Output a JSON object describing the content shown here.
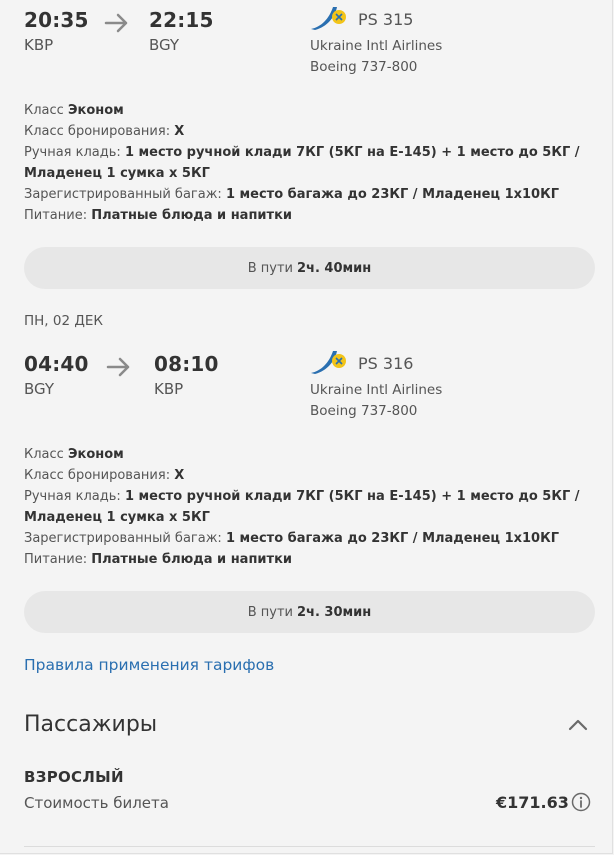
{
  "segments": [
    {
      "dep_time": "20:35",
      "dep_code": "KBP",
      "arr_time": "22:15",
      "arr_code": "BGY",
      "flight_no": "PS 315",
      "airline": "Ukraine Intl Airlines",
      "aircraft": "Boeing 737-800",
      "class_label": "Класс",
      "class_value": "Эконом",
      "booking_label": "Класс бронирования:",
      "booking_value": "X",
      "hand_label": "Ручная кладь:",
      "hand_value_1": "1 место ручной клади 7КГ (5КГ на E-145) + 1 место до 5КГ /",
      "hand_value_2": "Младенец 1 сумка x 5КГ",
      "baggage_label": "Зарегистрированный багаж:",
      "baggage_value": "1 место багажа до 23КГ / Младенец 1x10КГ",
      "meal_label": "Питание:",
      "meal_value": "Платные блюда и напитки",
      "duration_label": "В пути",
      "duration_value": "2ч. 40мин"
    },
    {
      "date": "ПН, 02 ДЕК",
      "dep_time": "04:40",
      "dep_code": "BGY",
      "arr_time": "08:10",
      "arr_code": "KBP",
      "flight_no": "PS 316",
      "airline": "Ukraine Intl Airlines",
      "aircraft": "Boeing 737-800",
      "class_label": "Класс",
      "class_value": "Эконом",
      "booking_label": "Класс бронирования:",
      "booking_value": "X",
      "hand_label": "Ручная кладь:",
      "hand_value_1": "1 место ручной клади 7КГ (5КГ на E-145) + 1 место до 5КГ /",
      "hand_value_2": "Младенец 1 сумка x 5КГ",
      "baggage_label": "Зарегистрированный багаж:",
      "baggage_value": "1 место багажа до 23КГ / Младенец 1x10КГ",
      "meal_label": "Питание:",
      "meal_value": "Платные блюда и напитки",
      "duration_label": "В пути",
      "duration_value": "2ч. 30мин"
    }
  ],
  "fare_rules_link": "Правила применения тарифов",
  "passengers": {
    "title": "Пассажиры",
    "type": "ВЗРОСЛЫЙ",
    "price_label": "Стоимость билета",
    "price": "€171.63"
  },
  "colors": {
    "link": "#2a6fb0",
    "airline_blue": "#2a6fb0",
    "airline_yellow": "#f2c419"
  },
  "icons": {
    "arrow": "arrow-right-icon",
    "logo": "airline-logo-icon",
    "collapse": "chevron-up-icon",
    "info": "info-icon"
  }
}
